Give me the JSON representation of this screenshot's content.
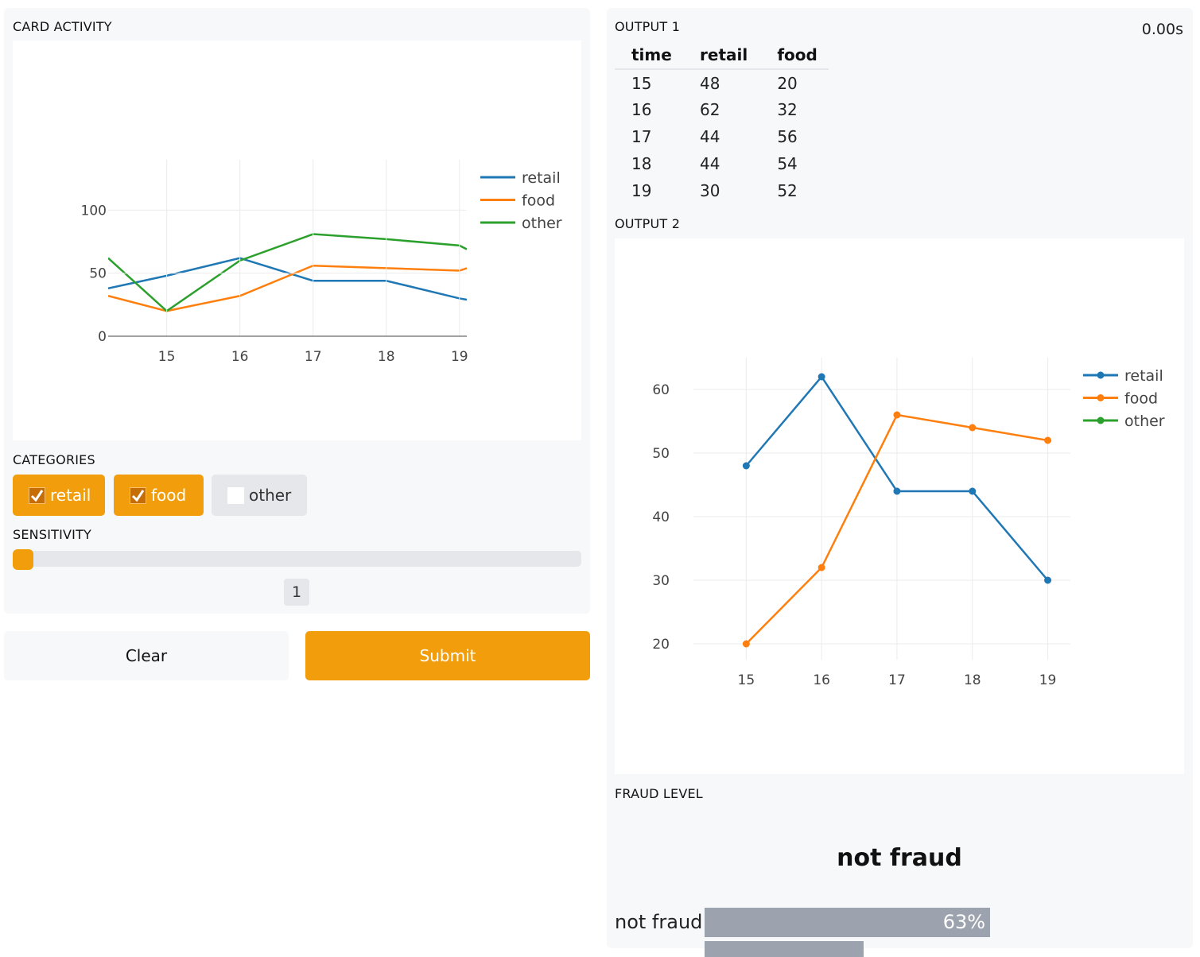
{
  "card_activity": {
    "label": "CARD ACTIVITY",
    "chart_data": {
      "type": "line",
      "x": [
        14.2,
        15,
        16,
        17,
        18,
        19,
        19.1
      ],
      "series": [
        {
          "name": "retail",
          "color": "#1f77b4",
          "values": [
            38,
            48,
            62,
            44,
            44,
            30,
            29
          ]
        },
        {
          "name": "food",
          "color": "#ff7f0e",
          "values": [
            32,
            20,
            32,
            56,
            54,
            52,
            54
          ]
        },
        {
          "name": "other",
          "color": "#2ca02c",
          "values": [
            62,
            20,
            60,
            81,
            77,
            72,
            69
          ]
        }
      ],
      "x_ticks": [
        "15",
        "16",
        "17",
        "18",
        "19"
      ],
      "y_ticks": [
        "0",
        "50",
        "100"
      ],
      "xlim": [
        14.2,
        19.1
      ],
      "ylim": [
        0,
        140
      ],
      "legend": "top-right"
    }
  },
  "categories": {
    "label": "CATEGORIES",
    "items": [
      {
        "label": "retail",
        "checked": true
      },
      {
        "label": "food",
        "checked": true
      },
      {
        "label": "other",
        "checked": false
      }
    ]
  },
  "sensitivity": {
    "label": "SENSITIVITY",
    "value": "1",
    "fraction": 0.0
  },
  "buttons": {
    "clear": "Clear",
    "submit": "Submit"
  },
  "output1": {
    "label": "OUTPUT 1",
    "timer": "0.00s",
    "columns": [
      "time",
      "retail",
      "food"
    ],
    "rows": [
      [
        "15",
        "48",
        "20"
      ],
      [
        "16",
        "62",
        "32"
      ],
      [
        "17",
        "44",
        "56"
      ],
      [
        "18",
        "44",
        "54"
      ],
      [
        "19",
        "30",
        "52"
      ]
    ]
  },
  "output2": {
    "label": "OUTPUT 2",
    "chart_data": {
      "type": "line",
      "x": [
        15,
        16,
        17,
        18,
        19
      ],
      "series": [
        {
          "name": "retail",
          "color": "#1f77b4",
          "values": [
            48,
            62,
            44,
            44,
            30
          ]
        },
        {
          "name": "food",
          "color": "#ff7f0e",
          "values": [
            20,
            32,
            56,
            54,
            52
          ]
        },
        {
          "name": "other",
          "color": "#2ca02c",
          "values": []
        }
      ],
      "x_ticks": [
        "15",
        "16",
        "17",
        "18",
        "19"
      ],
      "y_ticks": [
        "20",
        "30",
        "40",
        "50",
        "60"
      ],
      "markers": true,
      "legend": "top-right"
    }
  },
  "fraud": {
    "label": "FRAUD LEVEL",
    "result": "not fraud",
    "bars": [
      {
        "label": "not fraud",
        "value": 0.63,
        "text": "63%"
      },
      {
        "label": "",
        "value": 0.35,
        "text": ""
      }
    ]
  },
  "colors": {
    "accent": "#f29e0c",
    "panel": "#f7f8fa",
    "bar": "#9ca3af"
  }
}
